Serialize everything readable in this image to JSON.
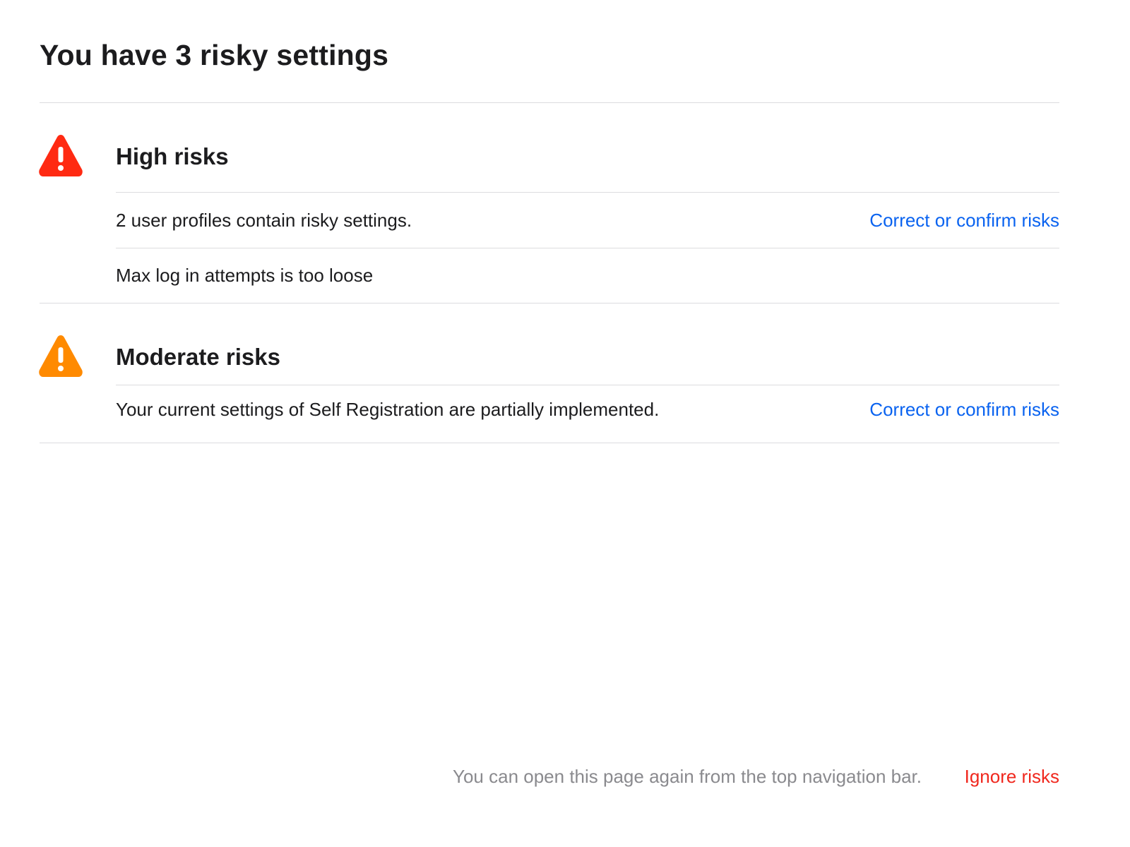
{
  "page": {
    "title": "You have 3 risky settings"
  },
  "sections": [
    {
      "heading": "High risks",
      "icon": "warning-triangle-icon",
      "icon_color": "#ff2a12",
      "items": [
        {
          "text": "2 user profiles contain risky settings.",
          "action": "Correct or confirm risks"
        },
        {
          "text": "Max log in attempts is too loose"
        }
      ]
    },
    {
      "heading": "Moderate risks",
      "icon": "warning-triangle-icon",
      "icon_color": "#ff8a00",
      "items": [
        {
          "text": "Your current settings of Self Registration are partially implemented.",
          "action": "Correct or confirm risks"
        }
      ]
    }
  ],
  "footer": {
    "note": "You can open this page again from the top navigation bar.",
    "ignore_label": "Ignore risks"
  },
  "colors": {
    "link": "#0a63f0",
    "danger_link": "#f0281e",
    "divider": "#dcdcdf",
    "muted_text": "#8a8a8e"
  }
}
